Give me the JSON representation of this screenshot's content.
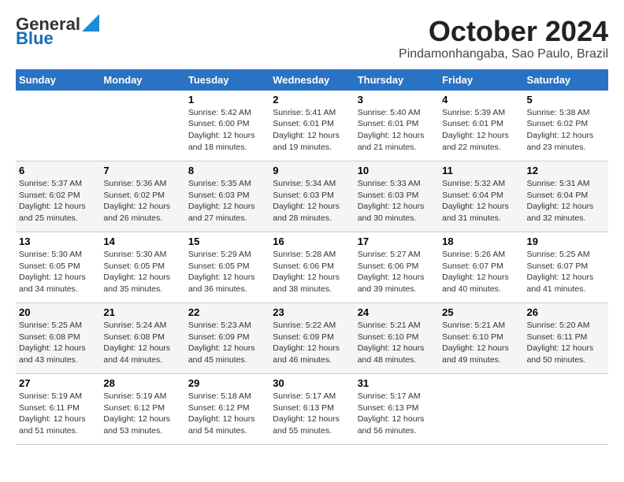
{
  "header": {
    "logo_general": "General",
    "logo_blue": "Blue",
    "month": "October 2024",
    "location": "Pindamonhangaba, Sao Paulo, Brazil"
  },
  "columns": [
    "Sunday",
    "Monday",
    "Tuesday",
    "Wednesday",
    "Thursday",
    "Friday",
    "Saturday"
  ],
  "weeks": [
    [
      {
        "day": "",
        "info": ""
      },
      {
        "day": "",
        "info": ""
      },
      {
        "day": "1",
        "info": "Sunrise: 5:42 AM\nSunset: 6:00 PM\nDaylight: 12 hours and 18 minutes."
      },
      {
        "day": "2",
        "info": "Sunrise: 5:41 AM\nSunset: 6:01 PM\nDaylight: 12 hours and 19 minutes."
      },
      {
        "day": "3",
        "info": "Sunrise: 5:40 AM\nSunset: 6:01 PM\nDaylight: 12 hours and 21 minutes."
      },
      {
        "day": "4",
        "info": "Sunrise: 5:39 AM\nSunset: 6:01 PM\nDaylight: 12 hours and 22 minutes."
      },
      {
        "day": "5",
        "info": "Sunrise: 5:38 AM\nSunset: 6:02 PM\nDaylight: 12 hours and 23 minutes."
      }
    ],
    [
      {
        "day": "6",
        "info": "Sunrise: 5:37 AM\nSunset: 6:02 PM\nDaylight: 12 hours and 25 minutes."
      },
      {
        "day": "7",
        "info": "Sunrise: 5:36 AM\nSunset: 6:02 PM\nDaylight: 12 hours and 26 minutes."
      },
      {
        "day": "8",
        "info": "Sunrise: 5:35 AM\nSunset: 6:03 PM\nDaylight: 12 hours and 27 minutes."
      },
      {
        "day": "9",
        "info": "Sunrise: 5:34 AM\nSunset: 6:03 PM\nDaylight: 12 hours and 28 minutes."
      },
      {
        "day": "10",
        "info": "Sunrise: 5:33 AM\nSunset: 6:03 PM\nDaylight: 12 hours and 30 minutes."
      },
      {
        "day": "11",
        "info": "Sunrise: 5:32 AM\nSunset: 6:04 PM\nDaylight: 12 hours and 31 minutes."
      },
      {
        "day": "12",
        "info": "Sunrise: 5:31 AM\nSunset: 6:04 PM\nDaylight: 12 hours and 32 minutes."
      }
    ],
    [
      {
        "day": "13",
        "info": "Sunrise: 5:30 AM\nSunset: 6:05 PM\nDaylight: 12 hours and 34 minutes."
      },
      {
        "day": "14",
        "info": "Sunrise: 5:30 AM\nSunset: 6:05 PM\nDaylight: 12 hours and 35 minutes."
      },
      {
        "day": "15",
        "info": "Sunrise: 5:29 AM\nSunset: 6:05 PM\nDaylight: 12 hours and 36 minutes."
      },
      {
        "day": "16",
        "info": "Sunrise: 5:28 AM\nSunset: 6:06 PM\nDaylight: 12 hours and 38 minutes."
      },
      {
        "day": "17",
        "info": "Sunrise: 5:27 AM\nSunset: 6:06 PM\nDaylight: 12 hours and 39 minutes."
      },
      {
        "day": "18",
        "info": "Sunrise: 5:26 AM\nSunset: 6:07 PM\nDaylight: 12 hours and 40 minutes."
      },
      {
        "day": "19",
        "info": "Sunrise: 5:25 AM\nSunset: 6:07 PM\nDaylight: 12 hours and 41 minutes."
      }
    ],
    [
      {
        "day": "20",
        "info": "Sunrise: 5:25 AM\nSunset: 6:08 PM\nDaylight: 12 hours and 43 minutes."
      },
      {
        "day": "21",
        "info": "Sunrise: 5:24 AM\nSunset: 6:08 PM\nDaylight: 12 hours and 44 minutes."
      },
      {
        "day": "22",
        "info": "Sunrise: 5:23 AM\nSunset: 6:09 PM\nDaylight: 12 hours and 45 minutes."
      },
      {
        "day": "23",
        "info": "Sunrise: 5:22 AM\nSunset: 6:09 PM\nDaylight: 12 hours and 46 minutes."
      },
      {
        "day": "24",
        "info": "Sunrise: 5:21 AM\nSunset: 6:10 PM\nDaylight: 12 hours and 48 minutes."
      },
      {
        "day": "25",
        "info": "Sunrise: 5:21 AM\nSunset: 6:10 PM\nDaylight: 12 hours and 49 minutes."
      },
      {
        "day": "26",
        "info": "Sunrise: 5:20 AM\nSunset: 6:11 PM\nDaylight: 12 hours and 50 minutes."
      }
    ],
    [
      {
        "day": "27",
        "info": "Sunrise: 5:19 AM\nSunset: 6:11 PM\nDaylight: 12 hours and 51 minutes."
      },
      {
        "day": "28",
        "info": "Sunrise: 5:19 AM\nSunset: 6:12 PM\nDaylight: 12 hours and 53 minutes."
      },
      {
        "day": "29",
        "info": "Sunrise: 5:18 AM\nSunset: 6:12 PM\nDaylight: 12 hours and 54 minutes."
      },
      {
        "day": "30",
        "info": "Sunrise: 5:17 AM\nSunset: 6:13 PM\nDaylight: 12 hours and 55 minutes."
      },
      {
        "day": "31",
        "info": "Sunrise: 5:17 AM\nSunset: 6:13 PM\nDaylight: 12 hours and 56 minutes."
      },
      {
        "day": "",
        "info": ""
      },
      {
        "day": "",
        "info": ""
      }
    ]
  ]
}
